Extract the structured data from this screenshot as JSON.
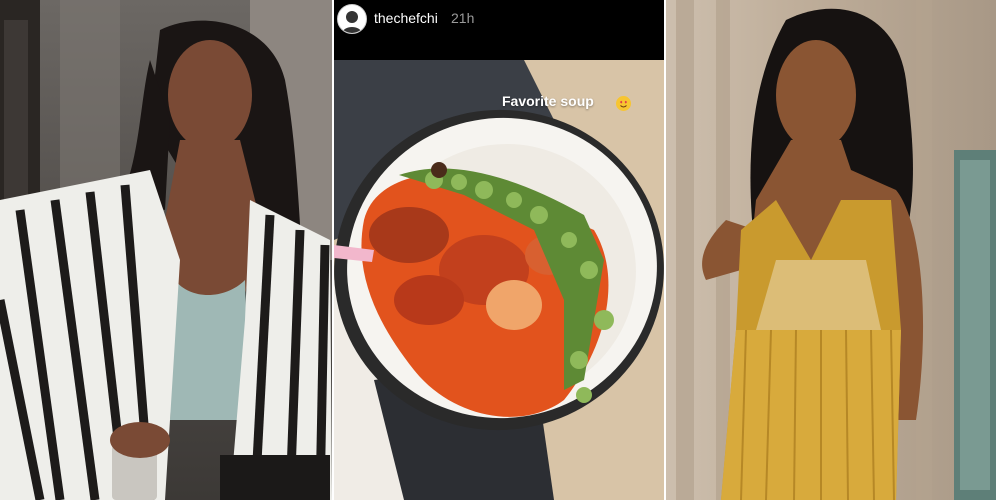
{
  "story": {
    "username": "thechefchi",
    "time": "21h",
    "caption": "Favorite soup",
    "caption_emoji": "heart-eyes-emoji"
  },
  "colors": {
    "story_bar": "#000000",
    "caption_text": "#ffffff",
    "soup": "#e2531d",
    "bowl_rim": "#2a2a2a",
    "okra": "#5e8a35",
    "dress_gold": "#c99a2e"
  }
}
